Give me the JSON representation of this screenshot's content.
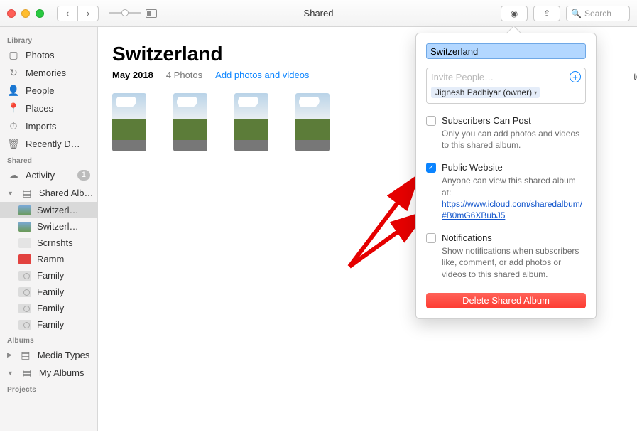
{
  "window": {
    "title": "Shared"
  },
  "toolbar": {
    "search_placeholder": "Search",
    "back_glyph": "‹",
    "fwd_glyph": "›"
  },
  "sidebar": {
    "sections": {
      "library": {
        "header": "Library",
        "items": [
          {
            "label": "Photos",
            "glyph": "▢"
          },
          {
            "label": "Memories",
            "glyph": "↻"
          },
          {
            "label": "People",
            "glyph": "👤"
          },
          {
            "label": "Places",
            "glyph": "📍"
          },
          {
            "label": "Imports",
            "glyph": "⏱"
          },
          {
            "label": "Recently D…",
            "glyph": "🗑"
          }
        ]
      },
      "shared": {
        "header": "Shared",
        "activity": {
          "label": "Activity",
          "glyph": "☁",
          "badge": "1"
        },
        "albums_root": "Shared Alb…",
        "items": [
          {
            "label": "Switzerl…"
          },
          {
            "label": "Switzerl…"
          },
          {
            "label": "Scrnshts"
          },
          {
            "label": "Ramm"
          },
          {
            "label": "Family"
          },
          {
            "label": "Family"
          },
          {
            "label": "Family"
          },
          {
            "label": "Family"
          }
        ]
      },
      "albums": {
        "header": "Albums",
        "items": [
          {
            "label": "Media Types"
          },
          {
            "label": "My Albums"
          }
        ]
      },
      "projects": {
        "header": "Projects"
      }
    }
  },
  "main": {
    "title": "Switzerland",
    "date": "May 2018",
    "count": "4 Photos",
    "add_link": "Add photos and videos",
    "dropdown": "tos"
  },
  "popover": {
    "name_value": "Switzerland",
    "invite_placeholder": "Invite People…",
    "owner": "Jignesh Padhiyar (owner)",
    "subscribers": {
      "label": "Subscribers Can Post",
      "desc": "Only you can add photos and videos to this shared album."
    },
    "public": {
      "label": "Public Website",
      "desc_prefix": "Anyone can view this shared album at:",
      "url": "https://www.icloud.com/sharedalbum/#B0mG6XBubJ5"
    },
    "notifications": {
      "label": "Notifications",
      "desc": "Show notifications when subscribers like, comment, or add photos or videos to this shared album."
    },
    "delete": "Delete Shared Album"
  }
}
